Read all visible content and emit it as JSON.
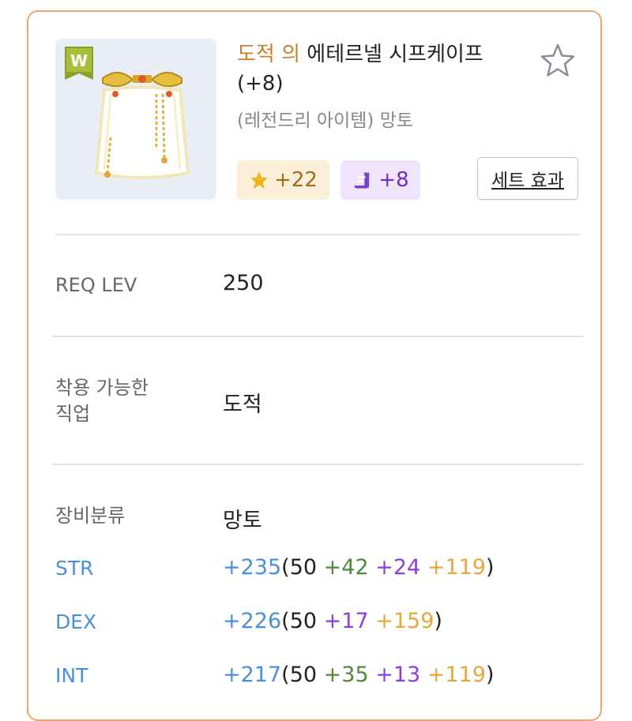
{
  "item": {
    "name_prefix": "도적 의",
    "name": "에테르넬 시프케이프",
    "upgrade": "(+8)",
    "subtitle": "(레전드리 아이템) 망토",
    "star_force": "+22",
    "scroll_count": "+8",
    "set_button": "세트 효과",
    "icon_letter": "W"
  },
  "colors": {
    "border": "#f0a56a",
    "prefix": "#c8822f",
    "stat_label": "#4a90d9",
    "bonus_add": "#4e8a3a",
    "bonus_star": "#8a3fe0",
    "bonus_potential": "#e6a83a"
  },
  "details": {
    "req_lev_label": "REQ LEV",
    "req_lev_value": "250",
    "job_label_line1": "착용 가능한",
    "job_label_line2": "직업",
    "job_value": "도적",
    "category_label": "장비분류",
    "category_value": "망토"
  },
  "stats": [
    {
      "label": "STR",
      "total": "+235",
      "base": "50",
      "add": "+42",
      "star": "+24",
      "potential": "+119"
    },
    {
      "label": "DEX",
      "total": "+226",
      "base": "50",
      "add": "",
      "star": "+17",
      "potential": "+159"
    },
    {
      "label": "INT",
      "total": "+217",
      "base": "50",
      "add": "+35",
      "star": "+13",
      "potential": "+119"
    }
  ]
}
